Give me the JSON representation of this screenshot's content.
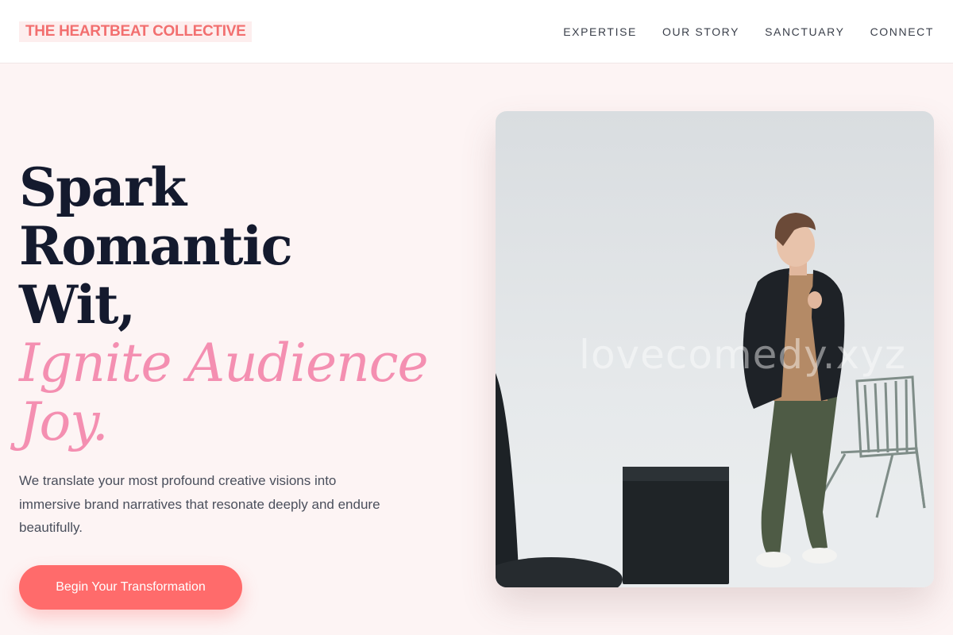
{
  "brand": {
    "name": "THE HEARTBEAT COLLECTIVE"
  },
  "nav": {
    "items": [
      {
        "label": "EXPERTISE"
      },
      {
        "label": "OUR STORY"
      },
      {
        "label": "SANCTUARY"
      },
      {
        "label": "CONNECT"
      }
    ]
  },
  "hero": {
    "headline_line1": "Spark Romantic",
    "headline_line2": "Wit,",
    "headline_accent_line1": "Ignite Audience",
    "headline_accent_line2": "Joy.",
    "description": "We translate your most profound creative visions into immersive brand narratives that resonate deeply and endure beautifully.",
    "cta_label": "Begin Your Transformation"
  },
  "photo": {
    "watermark": "lovecomedy.xyz"
  },
  "colors": {
    "accent": "#ff6b6b",
    "brand": "#f26f6f",
    "headline_accent": "#f48fb1",
    "headline": "#141a2e",
    "background": "#fdf4f4"
  }
}
